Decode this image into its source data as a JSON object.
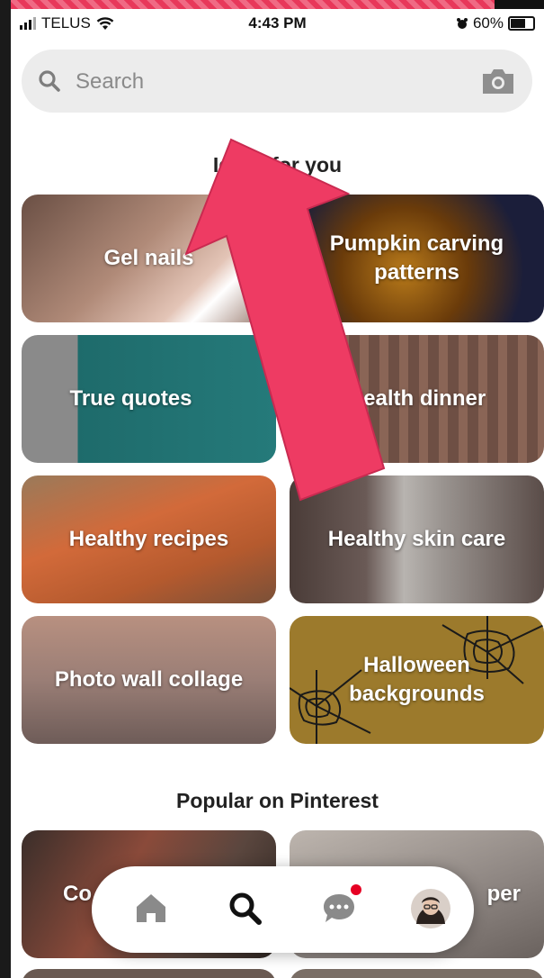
{
  "status_bar": {
    "carrier": "TELUS",
    "time": "4:43 PM",
    "battery": "60%",
    "icons": [
      "signal-icon",
      "wifi-icon",
      "alarm-icon",
      "battery-icon"
    ]
  },
  "search": {
    "placeholder": "Search",
    "icons": [
      "search-icon",
      "camera-icon"
    ]
  },
  "ideas_section": {
    "title": "Ideas for you",
    "tiles": [
      {
        "label": "Gel nails"
      },
      {
        "label": "Pumpkin carving patterns"
      },
      {
        "label": "True quotes"
      },
      {
        "label": "Health dinner"
      },
      {
        "label": "Healthy recipes"
      },
      {
        "label": "Healthy skin care"
      },
      {
        "label": "Photo wall collage"
      },
      {
        "label": "Halloween backgrounds"
      }
    ]
  },
  "popular_section": {
    "title": "Popular on Pinterest",
    "tiles": [
      {
        "label": "Co"
      },
      {
        "label": "per"
      }
    ]
  },
  "bottom_nav": {
    "items": [
      "home-icon",
      "search-icon",
      "messages-icon",
      "profile-avatar"
    ],
    "notification_color": "#e60023"
  },
  "annotation": {
    "arrow_color": "#ee3b63"
  }
}
